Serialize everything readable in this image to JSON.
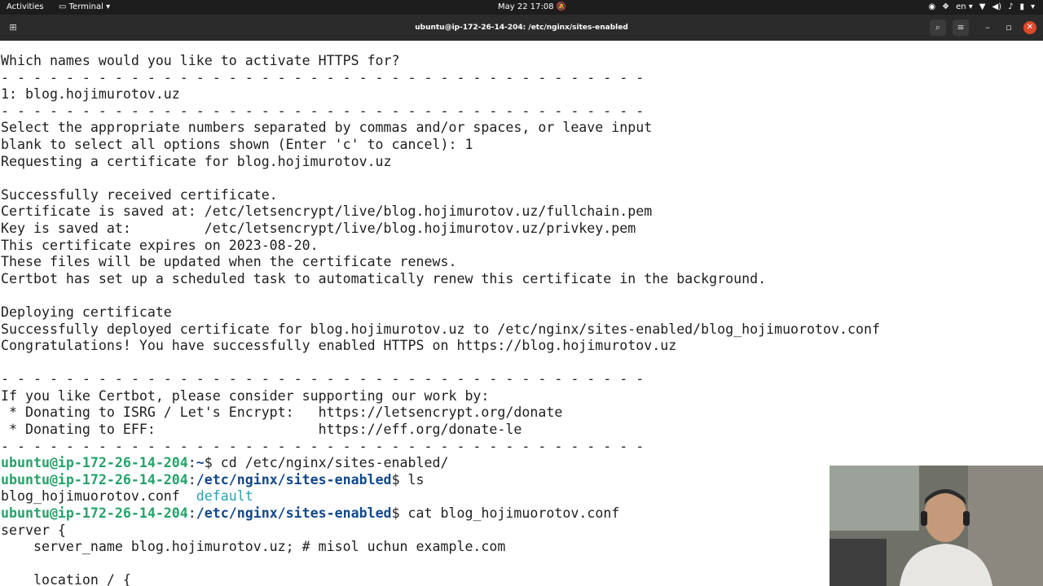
{
  "topbar": {
    "activities": "Activities",
    "app_name": "Terminal",
    "clock": "May 22  17:08",
    "lang": "en",
    "tray_icons": [
      "notifications-off-icon",
      "colorpicker-icon",
      "dropbox-icon",
      "wifi-icon",
      "volume-icon",
      "mic-icon",
      "battery-icon",
      "power-menu-icon"
    ]
  },
  "window": {
    "title": "ubuntu@ip-172-26-14-204: /etc/nginx/sites-enabled"
  },
  "terminal": {
    "lines": [
      "Which names would you like to activate HTTPS for?",
      "- - - - - - - - - - - - - - - - - - - - - - - - - - - - - - - - - - - - - - - -",
      "1: blog.hojimurotov.uz",
      "- - - - - - - - - - - - - - - - - - - - - - - - - - - - - - - - - - - - - - - -",
      "Select the appropriate numbers separated by commas and/or spaces, or leave input",
      "blank to select all options shown (Enter 'c' to cancel): 1",
      "Requesting a certificate for blog.hojimurotov.uz",
      "",
      "Successfully received certificate.",
      "Certificate is saved at: /etc/letsencrypt/live/blog.hojimurotov.uz/fullchain.pem",
      "Key is saved at:         /etc/letsencrypt/live/blog.hojimurotov.uz/privkey.pem",
      "This certificate expires on 2023-08-20.",
      "These files will be updated when the certificate renews.",
      "Certbot has set up a scheduled task to automatically renew this certificate in the background.",
      "",
      "Deploying certificate",
      "Successfully deployed certificate for blog.hojimurotov.uz to /etc/nginx/sites-enabled/blog_hojimuorotov.conf",
      "Congratulations! You have successfully enabled HTTPS on https://blog.hojimurotov.uz",
      "",
      "- - - - - - - - - - - - - - - - - - - - - - - - - - - - - - - - - - - - - - - -",
      "If you like Certbot, please consider supporting our work by:",
      " * Donating to ISRG / Let's Encrypt:   https://letsencrypt.org/donate",
      " * Donating to EFF:                    https://eff.org/donate-le",
      "- - - - - - - - - - - - - - - - - - - - - - - - - - - - - - - - - - - - - - - -"
    ],
    "prompt_user": "ubuntu@ip-172-26-14-204",
    "cmd1": {
      "path": "~",
      "command": "cd /etc/nginx/sites-enabled/"
    },
    "cmd2": {
      "path": "/etc/nginx/sites-enabled",
      "command": "ls"
    },
    "ls_output": {
      "file1": "blog_hojimuorotov.conf",
      "file2": "default"
    },
    "cmd3": {
      "path": "/etc/nginx/sites-enabled",
      "command": "cat blog_hojimuorotov.conf"
    },
    "conf_lines": [
      "server {",
      "    server_name blog.hojimurotov.uz; # misol uchun example.com",
      "",
      "    location / {"
    ]
  },
  "colors": {
    "prompt_user": "#26a269",
    "prompt_path": "#12488b",
    "ls_default": "#2aa1b3",
    "close_button": "#e0492a"
  }
}
